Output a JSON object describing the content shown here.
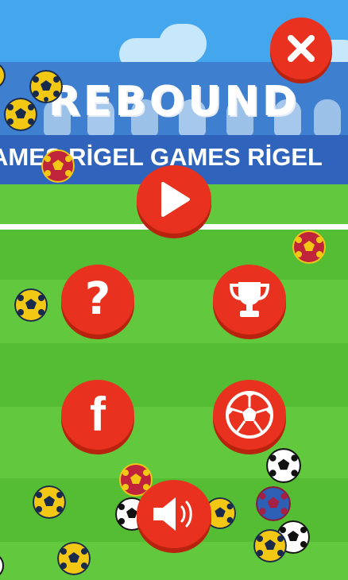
{
  "game": {
    "title": "REBOUND"
  },
  "banner": {
    "scroll_text": "AMES    RİGEL GAMES    RİGEL"
  },
  "colors": {
    "button_red": "#e8321f",
    "grass_light": "#62c93e",
    "grass_dark": "#52b82f",
    "banner_blue": "#2f63bc"
  },
  "buttons": {
    "close": {
      "icon": "close-icon"
    },
    "play": {
      "icon": "play-icon"
    },
    "help": {
      "icon": "question-icon",
      "label": "?"
    },
    "leaderboard": {
      "icon": "trophy-icon"
    },
    "facebook": {
      "icon": "facebook-icon",
      "label": "f"
    },
    "more_games": {
      "icon": "soccer-ball-icon"
    },
    "sound": {
      "icon": "speaker-icon"
    }
  }
}
